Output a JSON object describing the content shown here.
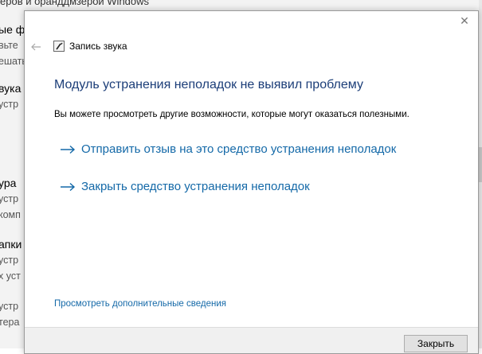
{
  "background_window": {
    "top_line": "еров и оранддмзерой Windows",
    "items": [
      {
        "title": "ые ф",
        "desc": [
          "вьте",
          "ешать"
        ]
      },
      {
        "title": "вука",
        "desc": [
          "устр"
        ]
      },
      {
        "title": "ура",
        "desc": [
          "устр",
          "комп"
        ]
      },
      {
        "title": "апки",
        "desc": [
          "устр",
          "х уст"
        ]
      },
      {
        "title": "",
        "desc": [
          "устр",
          "тера"
        ]
      }
    ]
  },
  "dialog": {
    "title": "Запись звука",
    "heading": "Модуль устранения неполадок не выявил проблему",
    "subtext": "Вы можете просмотреть другие возможности, которые могут оказаться полезными.",
    "options": [
      "Отправить отзыв на это средство устранения неполадок",
      "Закрыть средство устранения неполадок"
    ],
    "more_link": "Просмотреть дополнительные сведения",
    "close_button": "Закрыть",
    "close_glyph": "✕"
  },
  "colors": {
    "heading": "#1b3d78",
    "link": "#1469a8"
  }
}
